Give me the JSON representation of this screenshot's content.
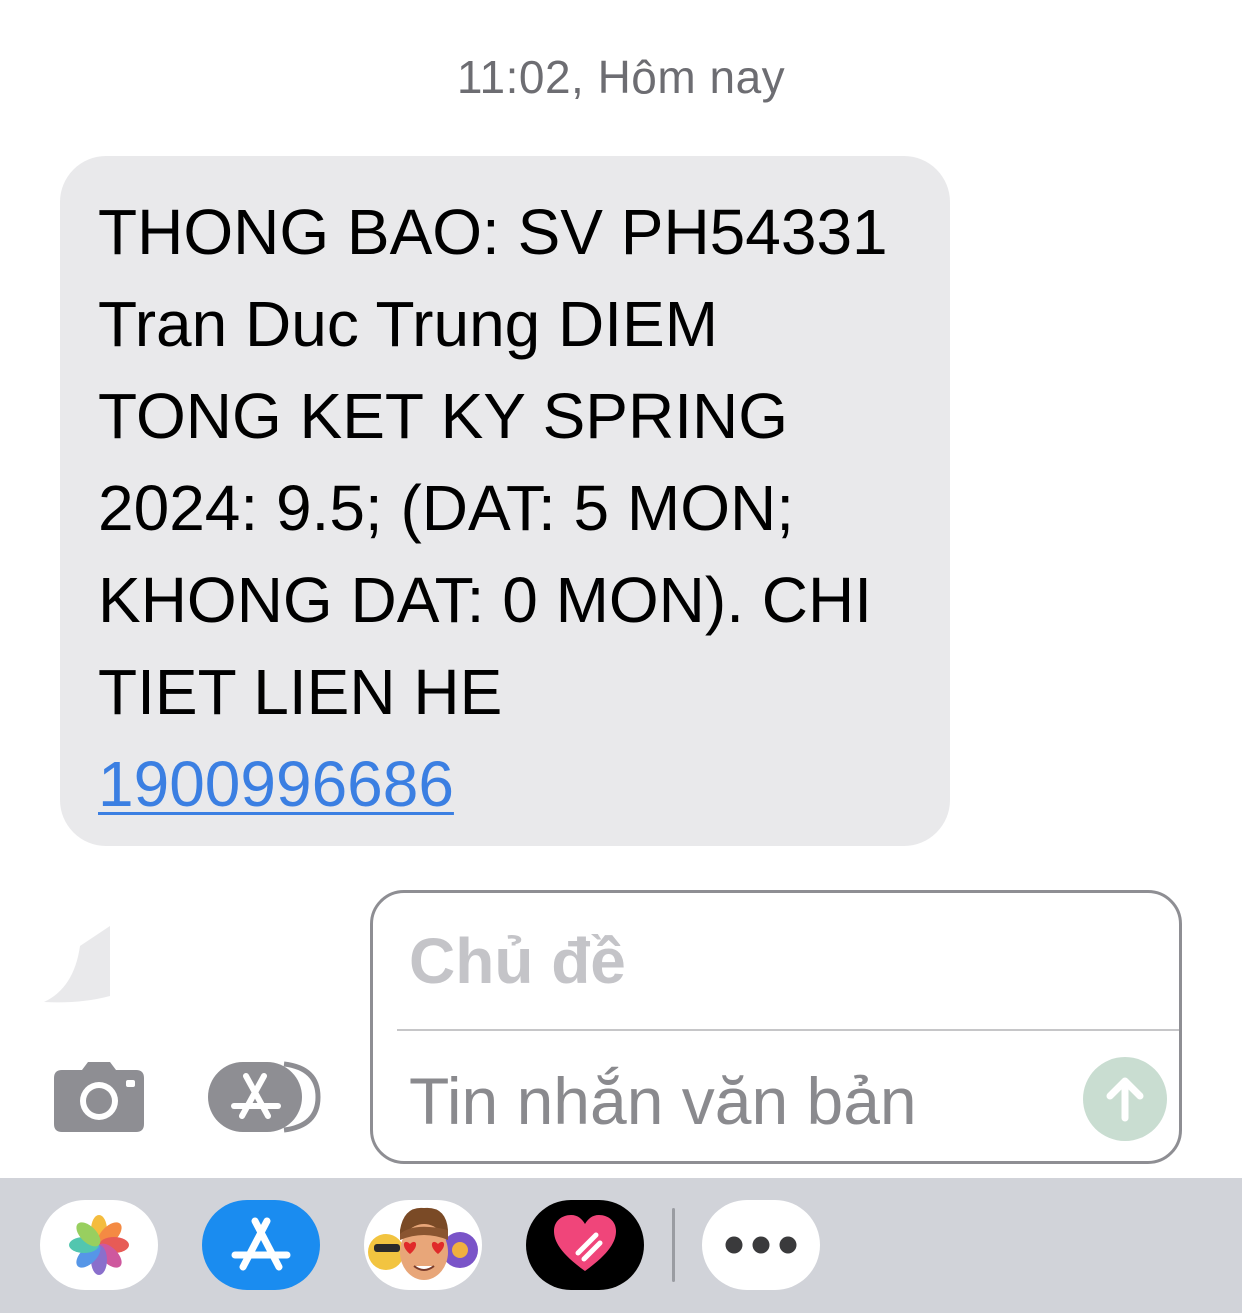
{
  "conversation": {
    "timestamp": "11:02, Hôm nay"
  },
  "message": {
    "text": "THONG BAO: SV PH54331\nTran Duc Trung DIEM\nTONG KET KY SPRING\n2024: 9.5; (DAT: 5 MON;\nKHONG DAT: 0 MON). CHI\nTIET LIEN HE",
    "phone_link": "1900996686",
    "bubble_color": "#e9e9eb",
    "link_color": "#3b7fe2"
  },
  "compose": {
    "subject_placeholder": "Chủ đề",
    "message_placeholder": "Tin nhắn văn bản",
    "send_icon": "arrow-up-icon",
    "send_color": "#c9ddd1"
  },
  "toolbar": {
    "camera_icon": "camera-icon",
    "apps_icon": "app-store-icon"
  },
  "app_bar": {
    "apps": [
      {
        "name": "photos",
        "icon": "photos-icon"
      },
      {
        "name": "app-store",
        "icon": "app-store-icon"
      },
      {
        "name": "memoji",
        "icon": "memoji-stickers-icon"
      },
      {
        "name": "digital-touch",
        "icon": "heart-icon"
      },
      {
        "name": "more",
        "icon": "ellipsis-icon"
      }
    ],
    "background": "#d1d3d9"
  }
}
